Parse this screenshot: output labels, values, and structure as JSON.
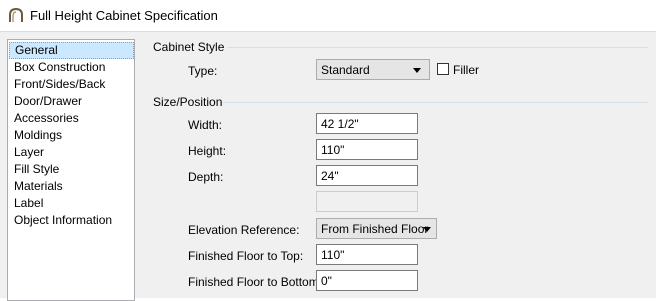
{
  "window": {
    "title": "Full Height Cabinet Specification",
    "icon": "cabinet-arch-icon"
  },
  "nav": {
    "items": [
      "General",
      "Box Construction",
      "Front/Sides/Back",
      "Door/Drawer",
      "Accessories",
      "Moldings",
      "Layer",
      "Fill Style",
      "Materials",
      "Label",
      "Object Information"
    ],
    "selected": "General"
  },
  "cabinet_style": {
    "title": "Cabinet Style",
    "type_label": "Type:",
    "type_value": "Standard",
    "filler_label": "Filler",
    "filler_checked": false
  },
  "size_position": {
    "title": "Size/Position",
    "width_label": "Width:",
    "width_value": "42 1/2\"",
    "height_label": "Height:",
    "height_value": "110\"",
    "depth_label": "Depth:",
    "depth_value": "24\"",
    "extra_value": "",
    "elevation_ref_label": "Elevation Reference:",
    "elevation_ref_value": "From Finished Floor",
    "floor_to_top_label": "Finished Floor to Top:",
    "floor_to_top_value": "110\"",
    "floor_to_bottom_label": "Finished Floor to Bottom:",
    "floor_to_bottom_value": "0\""
  }
}
